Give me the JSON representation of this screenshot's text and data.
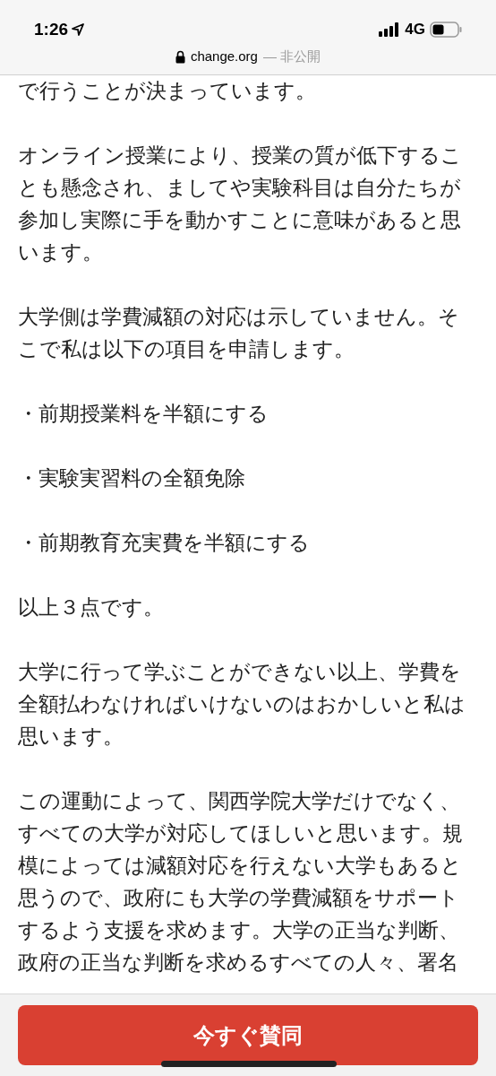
{
  "status_bar": {
    "time": "1:26",
    "network": "4G"
  },
  "address_bar": {
    "domain": "change.org",
    "suffix": "— 非公開"
  },
  "paragraphs": [
    "で行うことが決まっています。",
    "オンライン授業により、授業の質が低下することも懸念され、ましてや実験科目は自分たちが参加し実際に手を動かすことに意味があると思います。",
    "大学側は学費減額の対応は示していません。そこで私は以下の項目を申請します。",
    "・前期授業料を半額にする",
    "・実験実習料の全額免除",
    "・前期教育充実費を半額にする",
    "以上３点です。",
    "大学に行って学ぶことができない以上、学費を全額払わなければいけないのはおかしいと私は思います。",
    "この運動によって、関西学院大学だけでなく、すべての大学が対応してほしいと思います。規模によっては減額対応を行えない大学もあると思うので、政府にも大学の学費減額をサポートするよう支援を求めます。大学の正当な判断、政府の正当な判断を求めるすべての人々、署名"
  ],
  "action_button": {
    "label": "今すぐ賛同"
  }
}
